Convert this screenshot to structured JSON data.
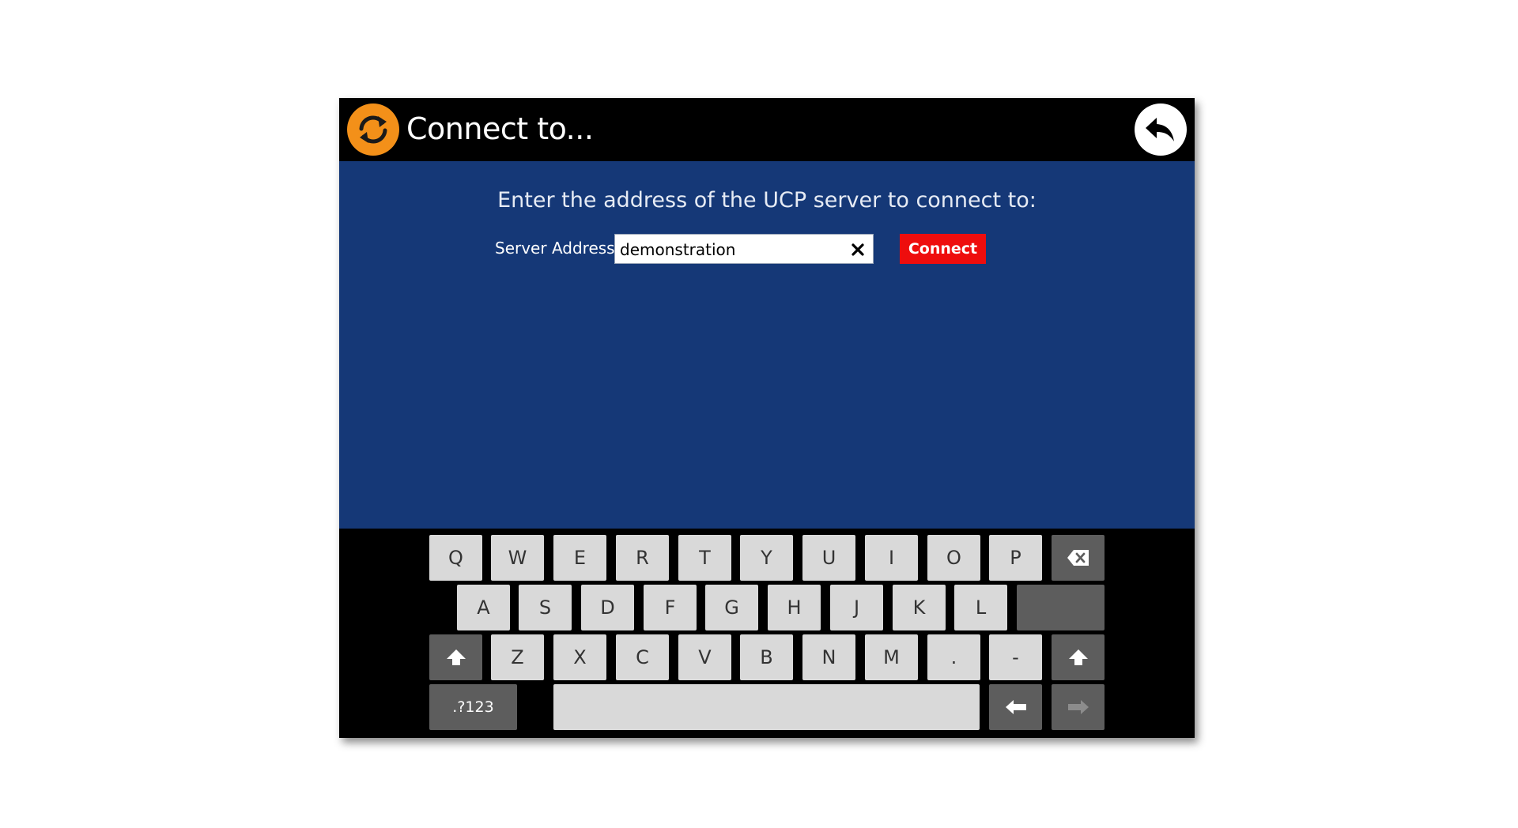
{
  "header": {
    "title": "Connect to...",
    "refresh_icon": "refresh-icon",
    "back_icon": "back-arrow-icon",
    "accent_color": "#f39019"
  },
  "main": {
    "prompt": "Enter the address of the UCP server to connect to:",
    "server_label": "Server Address",
    "server_value": "demonstration",
    "clear_icon": "close-icon",
    "connect_label": "Connect",
    "background_color": "#153877",
    "connect_color": "#ee0d0d"
  },
  "keyboard": {
    "row1": [
      "Q",
      "W",
      "E",
      "R",
      "T",
      "Y",
      "U",
      "I",
      "O",
      "P"
    ],
    "row2": [
      "A",
      "S",
      "D",
      "F",
      "G",
      "H",
      "J",
      "K",
      "L"
    ],
    "row3": [
      "Z",
      "X",
      "C",
      "V",
      "B",
      "N",
      "M",
      ".",
      "-"
    ],
    "symbols_label": ".?123",
    "backspace_icon": "backspace-icon",
    "shift_icon": "shift-icon",
    "left_arrow_icon": "arrow-left-icon",
    "right_arrow_icon": "arrow-right-icon"
  }
}
